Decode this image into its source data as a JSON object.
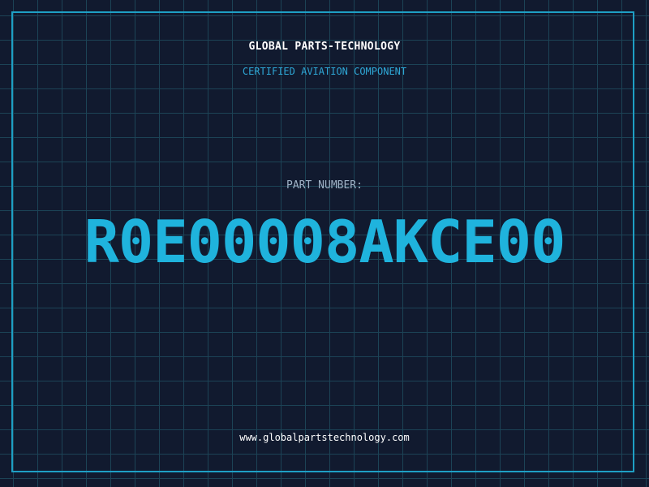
{
  "header": {
    "company_name": "GLOBAL PARTS-TECHNOLOGY",
    "tagline": "CERTIFIED AVIATION COMPONENT"
  },
  "part": {
    "label": "PART NUMBER:",
    "number": "R0E00008AKCE00"
  },
  "footer": {
    "website": "www.globalpartstechnology.com"
  },
  "colors": {
    "background": "#111a2f",
    "grid": "#1c4356",
    "border": "#1e9fc4",
    "accent": "#1fb3dd",
    "tagline": "#2ea7d6"
  }
}
